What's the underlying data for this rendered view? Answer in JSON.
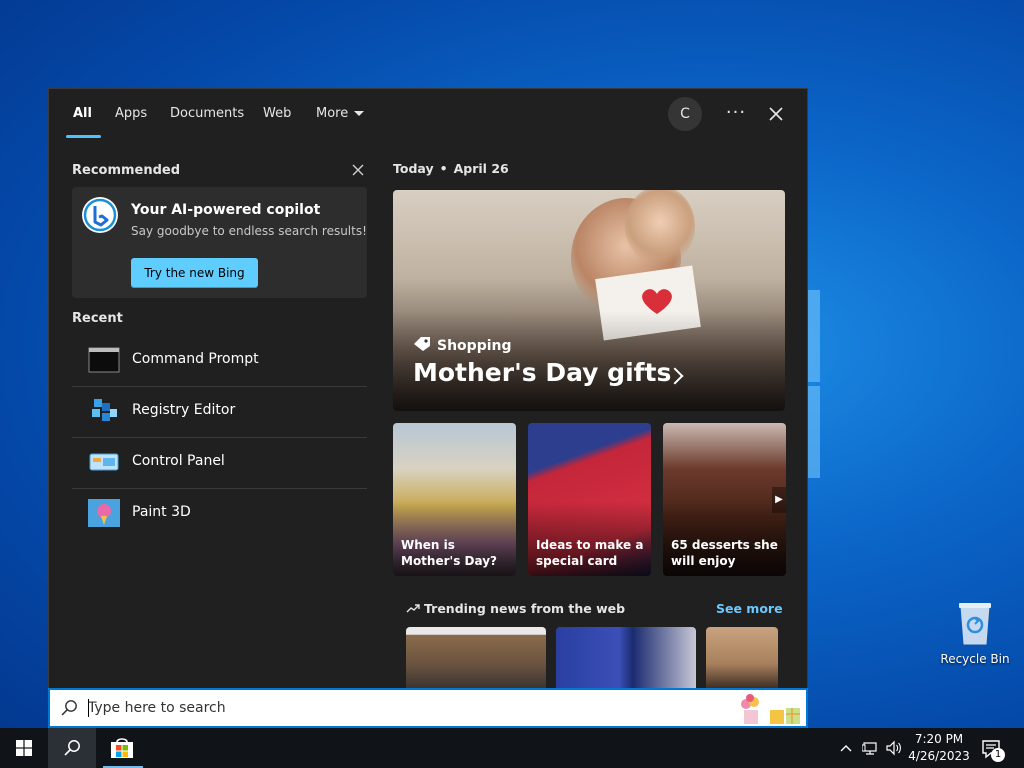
{
  "search_panel": {
    "tabs": [
      {
        "label": "All"
      },
      {
        "label": "Apps"
      },
      {
        "label": "Documents"
      },
      {
        "label": "Web"
      },
      {
        "label": "More"
      }
    ],
    "avatar_initial": "C",
    "more_options_label": "···",
    "recommended": {
      "title": "Recommended",
      "card_title": "Your AI-powered copilot",
      "card_subtitle": "Say goodbye to endless search results!",
      "button_label": "Try the new Bing"
    },
    "recent": {
      "title": "Recent",
      "items": [
        {
          "label": "Command Prompt",
          "icon": "command-prompt-icon"
        },
        {
          "label": "Registry Editor",
          "icon": "registry-editor-icon"
        },
        {
          "label": "Control Panel",
          "icon": "control-panel-icon"
        },
        {
          "label": "Paint 3D",
          "icon": "paint-3d-icon"
        }
      ]
    },
    "today": {
      "label": "Today",
      "separator": "•",
      "date": "April 26"
    },
    "hero": {
      "tag": "Shopping",
      "title": "Mother's Day gifts"
    },
    "cards": [
      {
        "label": "When is Mother's Day?"
      },
      {
        "label": "Ideas to make a special card"
      },
      {
        "label": "65 desserts she will enjoy"
      }
    ],
    "trending": {
      "title": "Trending news from the web",
      "see_more": "See more"
    }
  },
  "search_box": {
    "placeholder": "Type here to search"
  },
  "taskbar": {
    "time": "7:20 PM",
    "date": "4/26/2023",
    "notification_count": "1"
  },
  "desktop": {
    "recycle_bin_label": "Recycle Bin"
  },
  "colors": {
    "accent": "#4cc2ff",
    "bing_button": "#60cdff",
    "panel_bg": "#202020",
    "taskbar_bg": "#101318"
  }
}
